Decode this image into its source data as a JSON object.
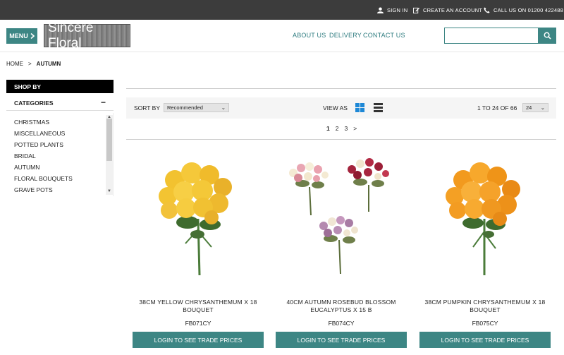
{
  "topbar": {
    "sign_in": "SIGN IN",
    "create_account": "CREATE AN ACCOUNT",
    "call_us": "CALL US ON 01200 422488"
  },
  "header": {
    "menu_label": "MENU",
    "logo_text": "Sincere Floral",
    "nav": [
      "ABOUT US",
      "DELIVERY",
      "CONTACT US"
    ],
    "search_placeholder": ""
  },
  "breadcrumb": {
    "home": "HOME",
    "separator": ">",
    "current": "AUTUMN"
  },
  "sidebar": {
    "shop_by": "SHOP BY",
    "categories_title": "CATEGORIES",
    "categories": [
      "CHRISTMAS",
      "MISCELLANEOUS",
      "POTTED PLANTS",
      "BRIDAL",
      "AUTUMN",
      "FLORAL BOUQUETS",
      "GRAVE POTS"
    ]
  },
  "toolbar": {
    "sort_label": "SORT BY",
    "sort_value": "Recommended",
    "view_label": "VIEW AS",
    "count_text": "1 TO 24 OF 66",
    "per_page": "24"
  },
  "pagination": {
    "pages": [
      "1",
      "2",
      "3"
    ],
    "active": "1",
    "next": ">"
  },
  "products": [
    {
      "name": "38CM YELLOW CHRYSANTHEMUM X 18 BOUQUET",
      "code": "FB071CY",
      "button": "LOGIN TO SEE TRADE PRICES"
    },
    {
      "name": "40CM AUTUMN ROSEBUD BLOSSOM EUCALYPTUS X 15 B",
      "code": "FB074CY",
      "button": "LOGIN TO SEE TRADE PRICES"
    },
    {
      "name": "38CM PUMPKIN CHRYSANTHEMUM X 18 BOUQUET",
      "code": "FB075CY",
      "button": "LOGIN TO SEE TRADE PRICES"
    }
  ],
  "colors": {
    "accent": "#3d8684",
    "topbar": "#3c3c3c",
    "nav_link": "#2d7b7f"
  }
}
